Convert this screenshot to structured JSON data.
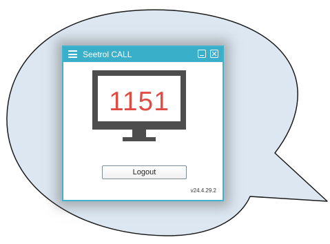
{
  "app": {
    "title": "Seetrol CALL",
    "code": "1151",
    "logout_label": "Logout",
    "version": "v24.4.29.2"
  },
  "icons": {
    "menu": "hamburger-menu-icon",
    "minimize": "minimize-icon",
    "close": "close-icon",
    "monitor": "monitor-icon"
  },
  "colors": {
    "accent": "#3aafca",
    "code_text": "#e04b43",
    "monitor": "#4d4d4d",
    "bubble_fill": "#dce7f2",
    "bubble_stroke": "#1a1a1a"
  }
}
